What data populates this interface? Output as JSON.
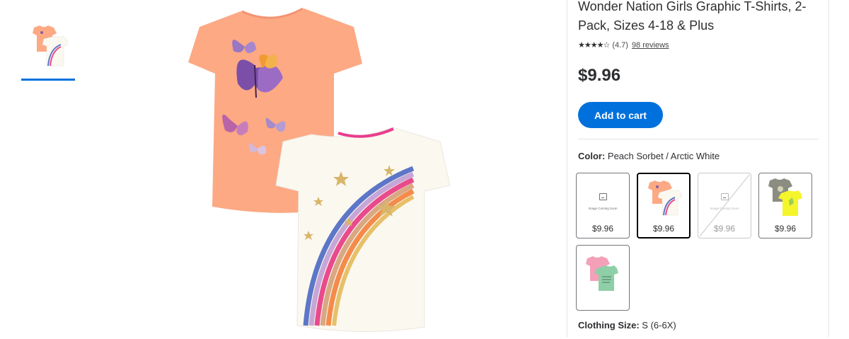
{
  "thumbnails": [
    {
      "name": "Wonder Nation girls tees 2-pack thumbnail",
      "selected": true
    }
  ],
  "product": {
    "title": "Wonder Nation Girls Graphic T-Shirts, 2-Pack, Sizes 4-18 & Plus",
    "stars_display": "★★★★☆",
    "rating": "(4.7)",
    "reviews": "98 reviews",
    "price": "$9.96",
    "add_to_cart": "Add to cart"
  },
  "color": {
    "label": "Color:",
    "value": "Peach Sorbet / Arctic White",
    "placeholder_text": "Image Coming Soon",
    "options": [
      {
        "price": "$9.96",
        "image": "placeholder",
        "selected": false,
        "available": true
      },
      {
        "price": "$9.96",
        "image": "peach-white-tees",
        "selected": true,
        "available": true
      },
      {
        "price": "$9.96",
        "image": "placeholder",
        "selected": false,
        "available": false
      },
      {
        "price": "$9.96",
        "image": "gray-yellow-tees",
        "selected": false,
        "available": true
      },
      {
        "price": "",
        "image": "pink-green-tees",
        "selected": false,
        "available": true
      }
    ]
  },
  "size": {
    "label": "Clothing Size:",
    "value": "S (6-6X)"
  },
  "colors": {
    "accent": "#0071dc",
    "peach": "#fca984",
    "white_tee": "#fbf8f0"
  }
}
